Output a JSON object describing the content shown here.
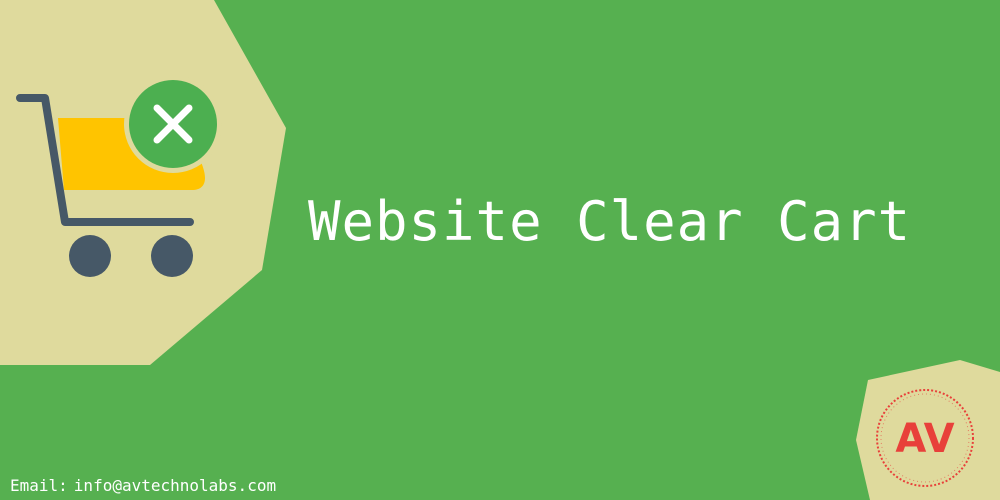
{
  "banner": {
    "title": "Website Clear Cart",
    "email_label": "Email:",
    "email_value": "info@avtechnolabs.com",
    "logo_text": "AV"
  },
  "icons": {
    "cart": "shopping-cart-icon",
    "clear": "close-x-icon",
    "logo": "av-logo-badge"
  },
  "colors": {
    "background": "#56b050",
    "shape": "#dfda9d",
    "cart_fill": "#ffc400",
    "cart_frame": "#465867",
    "badge": "#4caf50",
    "logo_red": "#e8403a",
    "text": "#ffffff"
  }
}
